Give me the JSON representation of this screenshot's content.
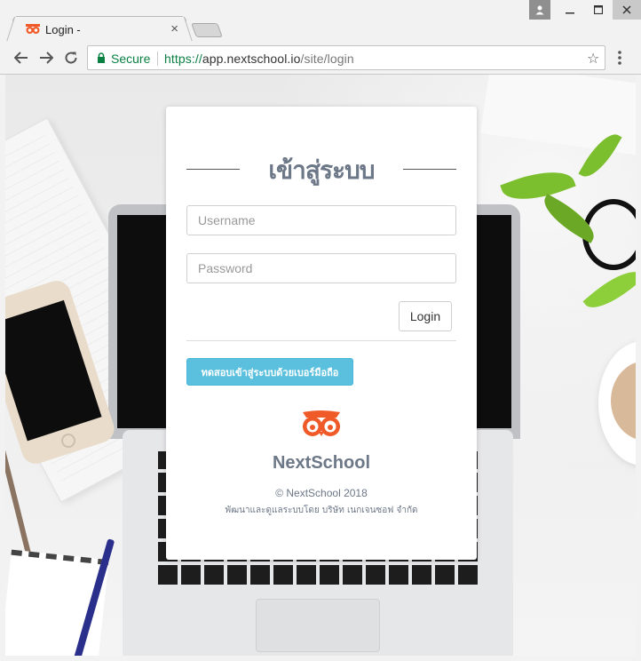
{
  "browser": {
    "tab_title": "Login -",
    "tab_close": "×",
    "url_secure_label": "Secure",
    "url_scheme": "https://",
    "url_host": "app.nextschool.io",
    "url_path": "/site/login",
    "icons": [
      "back-icon",
      "forward-icon",
      "reload-icon",
      "lock-icon",
      "star-icon",
      "menu-icon",
      "user-icon",
      "minimize-icon",
      "maximize-icon",
      "close-icon"
    ]
  },
  "login": {
    "heading": "เข้าสู่ระบบ",
    "username_placeholder": "Username",
    "password_placeholder": "Password",
    "login_button": "Login",
    "phone_login_button": "ทดสอบเข้าสู่ระบบด้วยเบอร์มือถือ",
    "brand": "NextSchool",
    "copyright": "© NextSchool 2018",
    "developer": "พัฒนาและดูแลระบบโดย บริษัท เนกเจนซอฟ จำกัด"
  },
  "colors": {
    "accent_button": "#5bc0de",
    "brand_text": "#6c7787",
    "logo": "#f05a28",
    "secure": "#0b8043"
  }
}
